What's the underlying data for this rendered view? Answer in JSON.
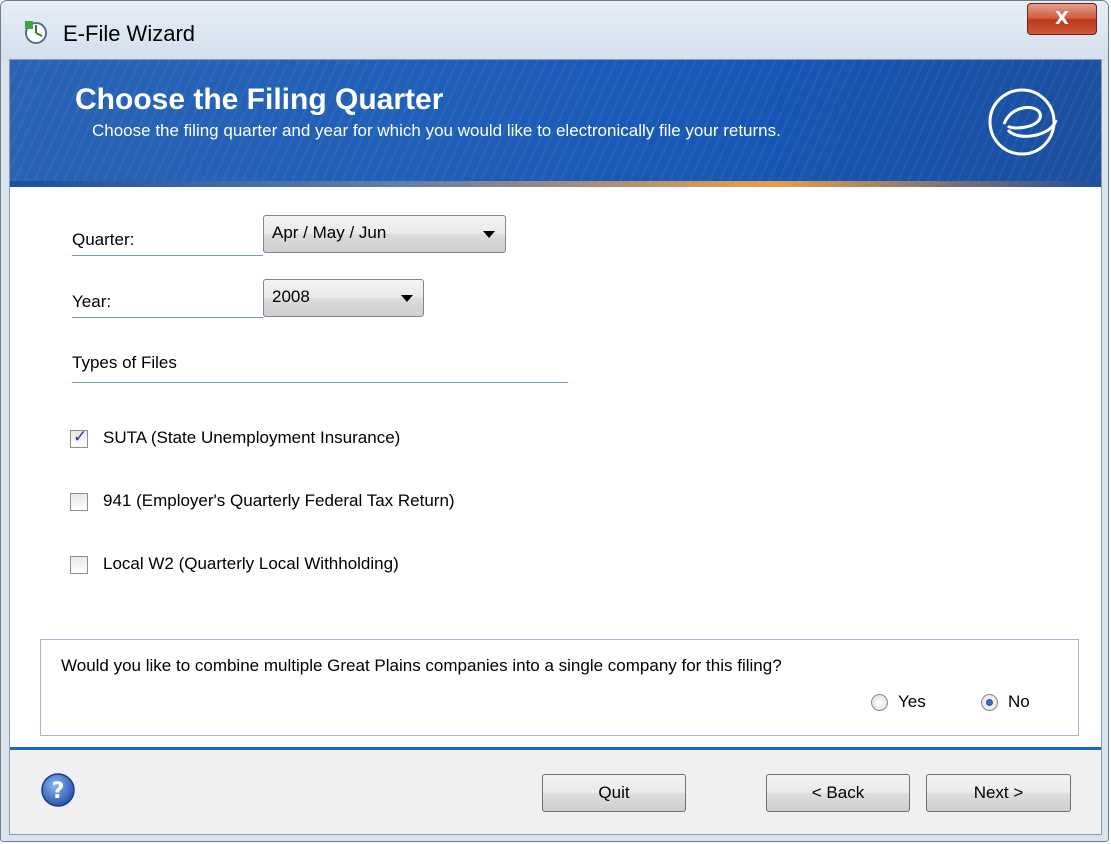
{
  "window": {
    "title": "E-File Wizard",
    "close_label": "X"
  },
  "banner": {
    "title": "Choose the Filing Quarter",
    "subtitle": "Choose the filing quarter and year for which you would like to electronically file your returns."
  },
  "form": {
    "quarter_label": "Quarter:",
    "quarter_value": "Apr / May / Jun",
    "year_label": "Year:",
    "year_value": "2008",
    "types_label": "Types of Files",
    "file_types": [
      {
        "label": "SUTA (State Unemployment Insurance)",
        "checked": true
      },
      {
        "label": "941 (Employer's Quarterly Federal Tax Return)",
        "checked": false
      },
      {
        "label": "Local W2 (Quarterly Local Withholding)",
        "checked": false
      }
    ]
  },
  "combine": {
    "question": "Would you like to combine multiple Great Plains companies into a single company for this filing?",
    "yes_label": "Yes",
    "no_label": "No",
    "selected": "No"
  },
  "footer": {
    "help_icon": "help-icon",
    "quit_label": "Quit",
    "back_label": "< Back",
    "next_label": "Next >"
  }
}
